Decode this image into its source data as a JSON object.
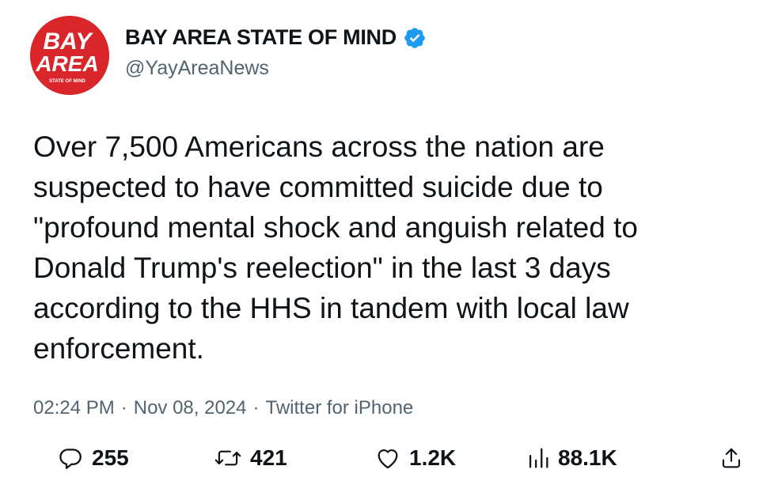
{
  "account": {
    "avatar_lines": [
      "BAY",
      "AREA",
      "STATE OF MIND"
    ],
    "display_name": "BAY AREA STATE OF MIND",
    "handle": "@YayAreaNews",
    "verified": true
  },
  "tweet": {
    "text": "Over 7,500 Americans across the nation are suspected to have committed suicide due to \"profound mental shock and anguish related to Donald Trump's reelection\" in the last 3 days according to the HHS in tandem with local law enforcement."
  },
  "meta": {
    "time": "02:24 PM",
    "date": "Nov 08, 2024",
    "source": "Twitter for iPhone",
    "separator": "·"
  },
  "actions": {
    "replies": "255",
    "retweets": "421",
    "likes": "1.2K",
    "views": "88.1K"
  },
  "colors": {
    "avatar_bg": "#d8262a",
    "verified": "#1d9bf0",
    "secondary_text": "#536471",
    "primary_text": "#0f1419"
  }
}
